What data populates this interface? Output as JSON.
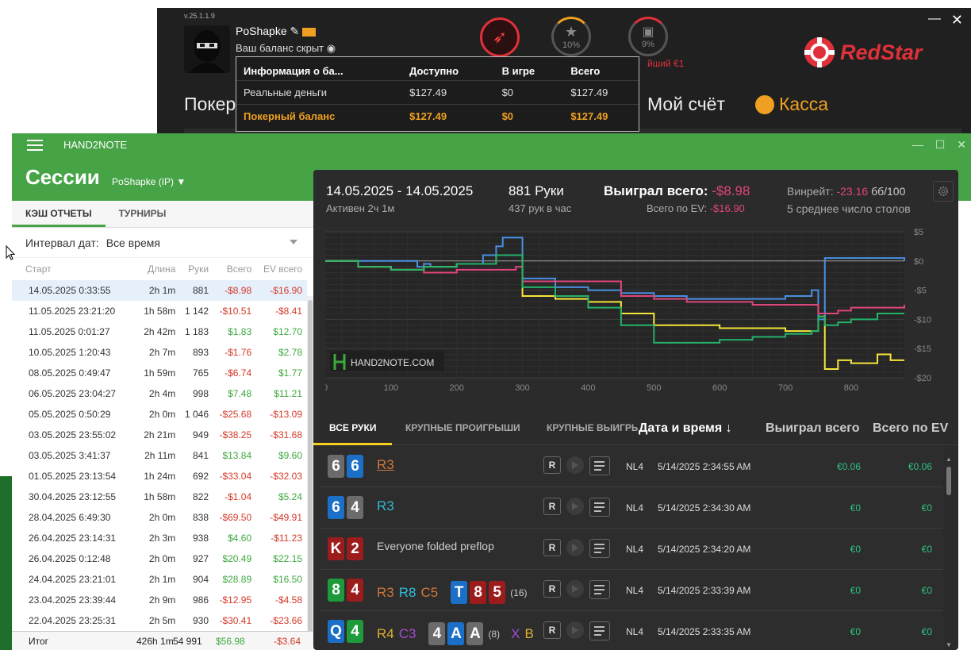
{
  "redstar": {
    "version": "v.25.1.1.9",
    "username": "PoShapke",
    "balance_label": "Ваш баланс скрыт",
    "star_progress": "10%",
    "gift_progress": "9%",
    "bonus_text": "йший €1",
    "logo_text": "RedStar",
    "nav_poker": "Покер",
    "nav_account": "Мой счёт",
    "nav_cashier": "Касса",
    "popup": {
      "headers": [
        "Информация о ба...",
        "Доступно",
        "В игре",
        "Всего"
      ],
      "rows": [
        [
          "Реальные деньги",
          "$127.49",
          "$0",
          "$127.49"
        ],
        [
          "Покерный баланс",
          "$127.49",
          "$0",
          "$127.49"
        ]
      ]
    }
  },
  "h2n": {
    "app_title": "HAND2NOTE",
    "sessions_title": "Сессии",
    "player": "PoShapke (IP)",
    "tabs": [
      "КЭШ ОТЧЕТЫ",
      "ТУРНИРЫ"
    ],
    "interval_label": "Интервал дат:",
    "interval_value": "Все время",
    "columns": [
      "Старт",
      "Длина",
      "Руки",
      "Всего",
      "EV всего"
    ],
    "sessions": [
      [
        "14.05.2025 0:33:55",
        "2h 1m",
        "881",
        "-$8.98",
        "-$16.90"
      ],
      [
        "11.05.2025 23:21:20",
        "1h 58m",
        "1 142",
        "-$10.51",
        "-$8.41"
      ],
      [
        "11.05.2025 0:01:27",
        "2h 42m",
        "1 183",
        "$1.83",
        "$12.70"
      ],
      [
        "10.05.2025 1:20:43",
        "2h 7m",
        "893",
        "-$1.76",
        "$2.78"
      ],
      [
        "08.05.2025 0:49:47",
        "1h 59m",
        "765",
        "-$6.74",
        "$1.77"
      ],
      [
        "06.05.2025 23:04:27",
        "2h 4m",
        "998",
        "$7.48",
        "$11.21"
      ],
      [
        "05.05.2025 0:50:29",
        "2h 0m",
        "1 046",
        "-$25.68",
        "-$13.09"
      ],
      [
        "03.05.2025 23:55:02",
        "2h 21m",
        "949",
        "-$38.25",
        "-$31.68"
      ],
      [
        "03.05.2025 3:41:37",
        "2h 11m",
        "841",
        "$13.84",
        "$9.60"
      ],
      [
        "01.05.2025 23:13:54",
        "1h 24m",
        "692",
        "-$33.04",
        "-$32.03"
      ],
      [
        "30.04.2025 23:12:55",
        "1h 58m",
        "822",
        "-$1.04",
        "$5.24"
      ],
      [
        "28.04.2025 6:49:30",
        "2h 0m",
        "838",
        "-$69.50",
        "-$49.91"
      ],
      [
        "26.04.2025 23:14:31",
        "2h 3m",
        "938",
        "$4.60",
        "-$11.23"
      ],
      [
        "26.04.2025 0:12:48",
        "2h 0m",
        "927",
        "$20.49",
        "$22.15"
      ],
      [
        "24.04.2025 23:21:01",
        "2h 1m",
        "904",
        "$28.89",
        "$16.50"
      ],
      [
        "23.04.2025 23:39:44",
        "2h 9m",
        "986",
        "-$12.95",
        "-$4.58"
      ],
      [
        "22.04.2025 23:25:31",
        "2h 5m",
        "930",
        "-$30.41",
        "-$23.66"
      ]
    ],
    "total": {
      "label": "Итог",
      "length": "426h 1m",
      "hands": "54 991",
      "won": "$56.98",
      "ev": "-$3.64"
    },
    "summary": {
      "date_range": "14.05.2025 - 14.05.2025",
      "active": "Активен 2ч 1м",
      "hands": "881 Руки",
      "hands_per_hour": "437 рук в час",
      "won_label": "Выиграл всего:",
      "won_value": "-$8.98",
      "ev_label": "Всего по EV:",
      "ev_value": "-$16.90",
      "winrate_label": "Винрейт:",
      "winrate_value": "-23.16",
      "winrate_unit": "бб/100",
      "tables": "5 среднее число столов"
    },
    "watermark": "HAND2NOTE.COM",
    "hand_tabs": [
      "ВСЕ РУКИ",
      "КРУПНЫЕ ПРОИГРЫШИ",
      "КРУПНЫЕ ВЫИГРЫ"
    ],
    "hand_columns": [
      "Дата и время ↓",
      "Выиграл всего",
      "Всего по EV"
    ],
    "hands": [
      {
        "cards": [
          [
            "6",
            "grey"
          ],
          [
            "6",
            "blue"
          ]
        ],
        "actions": [
          [
            "R3",
            "#d2763a"
          ]
        ],
        "board": [],
        "count": "",
        "limit": "NL4",
        "date": "5/14/2025 2:34:55 AM",
        "won": "€0.06",
        "ev": "€0.06"
      },
      {
        "cards": [
          [
            "6",
            "blue"
          ],
          [
            "4",
            "grey"
          ]
        ],
        "actions": [
          [
            "R3",
            "#2fbcd6"
          ]
        ],
        "board": [],
        "count": "",
        "limit": "NL4",
        "date": "5/14/2025 2:34:30 AM",
        "won": "€0",
        "ev": "€0"
      },
      {
        "cards": [
          [
            "K",
            "red"
          ],
          [
            "2",
            "red"
          ]
        ],
        "actions": [
          [
            "Everyone folded preflop",
            "#cccccc"
          ]
        ],
        "board": [],
        "count": "",
        "limit": "NL4",
        "date": "5/14/2025 2:34:20 AM",
        "won": "€0",
        "ev": "€0"
      },
      {
        "cards": [
          [
            "8",
            "green"
          ],
          [
            "4",
            "red"
          ]
        ],
        "actions": [
          [
            "R3",
            "#d2763a"
          ],
          [
            "R8",
            "#2fbcd6"
          ],
          [
            "C5",
            "#d2763a"
          ]
        ],
        "board": [
          [
            "T",
            "blue"
          ],
          [
            "8",
            "red"
          ],
          [
            "5",
            "red"
          ]
        ],
        "count": "(16)",
        "limit": "NL4",
        "date": "5/14/2025 2:33:39 AM",
        "won": "€0",
        "ev": "€0"
      },
      {
        "cards": [
          [
            "Q",
            "blue"
          ],
          [
            "4",
            "green"
          ]
        ],
        "actions": [
          [
            "R4",
            "#e0b030"
          ],
          [
            "C3",
            "#a34bd1"
          ]
        ],
        "board": [
          [
            "4",
            "grey"
          ],
          [
            "A",
            "blue"
          ],
          [
            "A",
            "grey"
          ]
        ],
        "count": "(8)",
        "extra": [
          [
            "X",
            "#a34bd1"
          ],
          [
            "B",
            "#e0b030"
          ]
        ],
        "limit": "NL4",
        "date": "5/14/2025 2:33:35 AM",
        "won": "€0",
        "ev": "€0"
      }
    ],
    "colors": {
      "brand_green": "#46a447",
      "negative": "#d33a2a",
      "positive": "#3da83d",
      "hl_yellow": "#f5d020"
    }
  },
  "chart_data": {
    "type": "line",
    "x_ticks": [
      "0",
      "100",
      "200",
      "300",
      "400",
      "500",
      "600",
      "700",
      "800"
    ],
    "y_ticks": [
      "$5",
      "$0",
      "-$5",
      "-$10",
      "-$15",
      "-$20"
    ],
    "xlim": [
      0,
      881
    ],
    "ylim": [
      -20,
      5
    ],
    "grid": true,
    "series": [
      {
        "color": "#4a90e2",
        "x": [
          0,
          100,
          140,
          150,
          160,
          200,
          240,
          260,
          270,
          280,
          290,
          300,
          350,
          400,
          450,
          500,
          550,
          600,
          650,
          700,
          740,
          750,
          760,
          780,
          800,
          840,
          881
        ],
        "y": [
          0,
          0,
          -1,
          -0.5,
          -1,
          -0.5,
          1,
          2.5,
          4,
          4,
          4,
          -3,
          -4.5,
          -5,
          -5.5,
          -6,
          -6.5,
          -6.5,
          -6.5,
          -6,
          -5,
          -10,
          0.5,
          0.5,
          0.5,
          0.5,
          0
        ]
      },
      {
        "color": "#e0457b",
        "x": [
          0,
          50,
          100,
          150,
          200,
          250,
          290,
          300,
          350,
          400,
          450,
          500,
          550,
          600,
          650,
          700,
          750,
          780,
          800,
          840,
          881
        ],
        "y": [
          0,
          -1,
          -1.5,
          -2,
          -1.5,
          -1.5,
          -1,
          -3.5,
          -3.5,
          -3.5,
          -6,
          -6.5,
          -7,
          -7,
          -7.5,
          -7.5,
          -9,
          -8.5,
          -8,
          -8,
          -7.5
        ]
      },
      {
        "color": "#f5e63a",
        "x": [
          0,
          50,
          100,
          150,
          200,
          230,
          260,
          290,
          300,
          350,
          400,
          450,
          500,
          550,
          600,
          650,
          700,
          740,
          750,
          760,
          780,
          800,
          840,
          860,
          881
        ],
        "y": [
          0,
          -1,
          -1.5,
          -1,
          -0.5,
          -0.5,
          1,
          1,
          -6,
          -6.5,
          -7,
          -9,
          -11,
          -11,
          -11.5,
          -11.5,
          -12,
          -12,
          -9.5,
          -18.5,
          -17,
          -17.5,
          -16,
          -17,
          -17
        ]
      },
      {
        "color": "#23b26a",
        "x": [
          0,
          50,
          100,
          150,
          200,
          230,
          260,
          290,
          300,
          350,
          400,
          450,
          500,
          550,
          600,
          650,
          700,
          740,
          750,
          760,
          780,
          800,
          840,
          860,
          881
        ],
        "y": [
          0,
          -1,
          -1.5,
          -1,
          -0.5,
          -0.5,
          1,
          1,
          -4.5,
          -6,
          -8,
          -11,
          -14,
          -14,
          -13.5,
          -13,
          -12.5,
          -12,
          -9.5,
          -11,
          -10.5,
          -10,
          -9,
          -9,
          -9
        ]
      }
    ]
  }
}
